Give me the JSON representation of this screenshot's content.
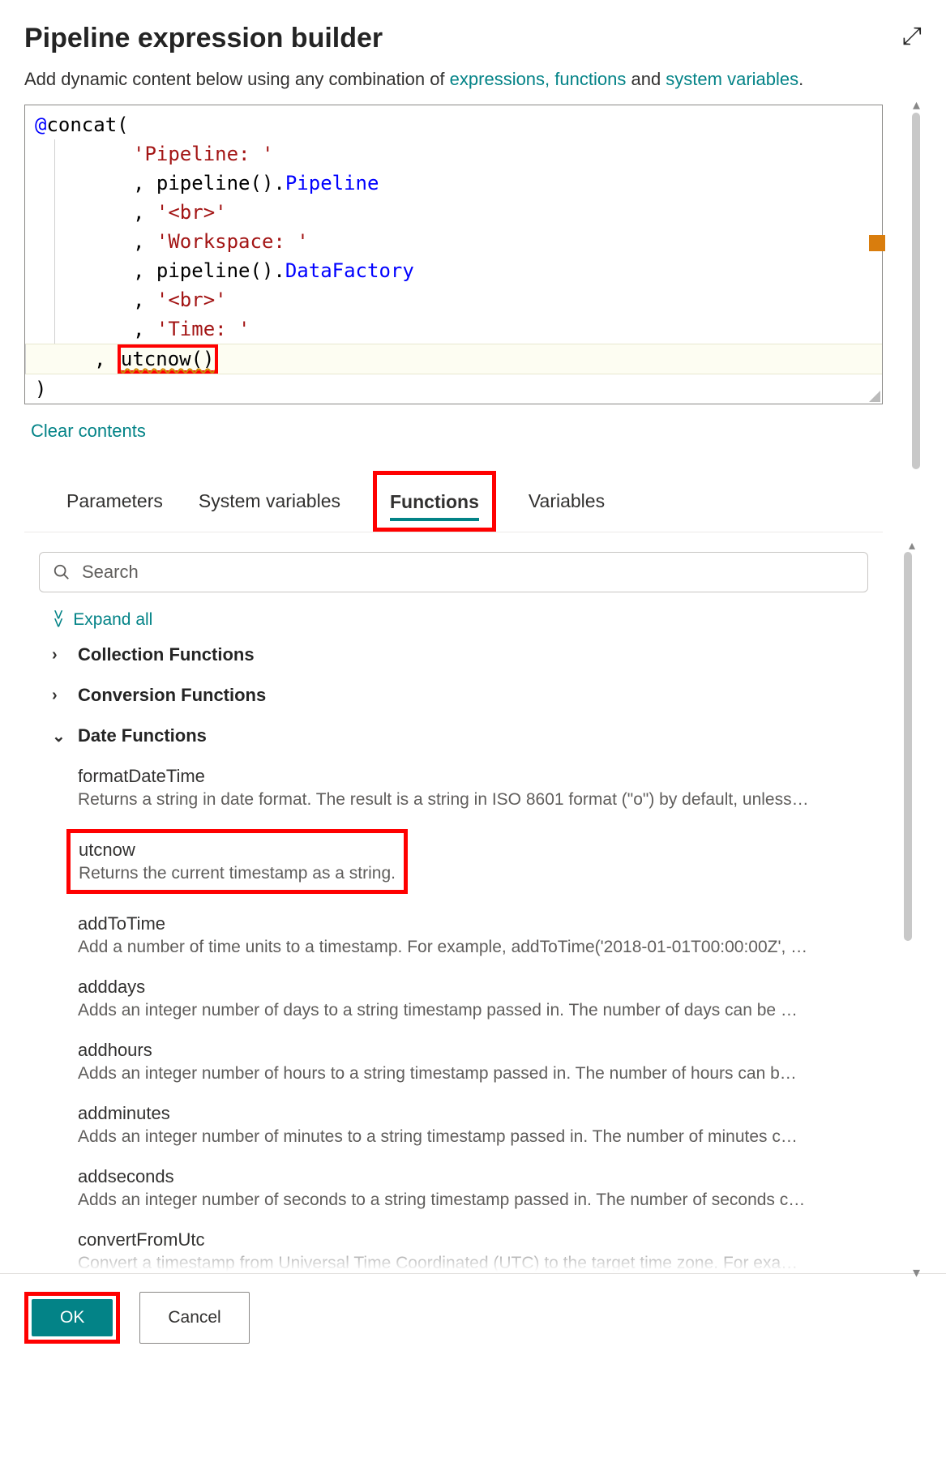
{
  "title": "Pipeline expression builder",
  "subtext": {
    "pre": "Add dynamic content below using any combination of ",
    "link1": "expressions,",
    "link2": "functions",
    "mid": " and ",
    "link3": "system variables",
    "post": "."
  },
  "editor": {
    "lines": [
      {
        "at": "@",
        "fn": "concat",
        "paren": "("
      },
      {
        "indent": true,
        "str": "'Pipeline: '"
      },
      {
        "indent": true,
        "comma": ", ",
        "plain1": "pipeline()",
        "dot": ".",
        "prop": "Pipeline"
      },
      {
        "indent": true,
        "comma": ", ",
        "str": "'<br>'"
      },
      {
        "indent": true,
        "comma": ", ",
        "str": "'Workspace: '"
      },
      {
        "indent": true,
        "comma": ", ",
        "plain1": "pipeline()",
        "dot": ".",
        "prop": "DataFactory"
      },
      {
        "indent": true,
        "comma": ", ",
        "str": "'<br>'"
      },
      {
        "indent": true,
        "comma": ", ",
        "str": "'Time: '"
      },
      {
        "indent": true,
        "comma": ", ",
        "utcnow": "utcnow()"
      },
      {
        "paren": ")"
      }
    ]
  },
  "clear_contents": "Clear contents",
  "tabs": [
    {
      "label": "Parameters",
      "active": false
    },
    {
      "label": "System variables",
      "active": false
    },
    {
      "label": "Functions",
      "active": true
    },
    {
      "label": "Variables",
      "active": false
    }
  ],
  "search_placeholder": "Search",
  "expand_all": "Expand all",
  "categories": [
    {
      "label": "Collection Functions",
      "open": false
    },
    {
      "label": "Conversion Functions",
      "open": false
    },
    {
      "label": "Date Functions",
      "open": true
    }
  ],
  "functions": [
    {
      "name": "formatDateTime",
      "desc": "Returns a string in date format. The result is a string in ISO 8601 format (\"o\") by default, unless…",
      "hl": false
    },
    {
      "name": "utcnow",
      "desc": "Returns the current timestamp as a string.",
      "hl": true
    },
    {
      "name": "addToTime",
      "desc": "Add a number of time units to a timestamp. For example, addToTime('2018-01-01T00:00:00Z', …",
      "hl": false
    },
    {
      "name": "adddays",
      "desc": "Adds an integer number of days to a string timestamp passed in. The number of days can be …",
      "hl": false
    },
    {
      "name": "addhours",
      "desc": "Adds an integer number of hours to a string timestamp passed in. The number of hours can b…",
      "hl": false
    },
    {
      "name": "addminutes",
      "desc": "Adds an integer number of minutes to a string timestamp passed in. The number of minutes c…",
      "hl": false
    },
    {
      "name": "addseconds",
      "desc": "Adds an integer number of seconds to a string timestamp passed in. The number of seconds c…",
      "hl": false
    }
  ],
  "cutoff": {
    "name": "convertFromUtc",
    "desc": "Convert a timestamp from Universal Time Coordinated (UTC) to the target time zone. For exa…"
  },
  "footer": {
    "ok": "OK",
    "cancel": "Cancel"
  }
}
